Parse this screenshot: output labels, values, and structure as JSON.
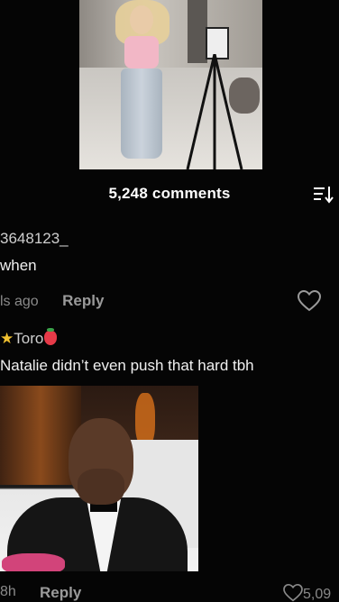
{
  "post": {
    "comments_count": "5,248 comments"
  },
  "comments": [
    {
      "username": "3648123_",
      "text": "when",
      "time": "ls ago",
      "reply_label": "Reply"
    },
    {
      "username": "Toro",
      "text": "Natalie didn’t even push that hard tbh",
      "bottom_time": "8h",
      "reply_label": "Reply",
      "likes": "5,09"
    }
  ],
  "icons": {
    "sort": "sort-icon",
    "heart": "heart-icon",
    "star": "★"
  },
  "colors": {
    "background": "#050505",
    "text": "#f0f0f0",
    "muted": "#8a8a8a",
    "star": "#f2c230",
    "strawberry": "#e63a48"
  }
}
